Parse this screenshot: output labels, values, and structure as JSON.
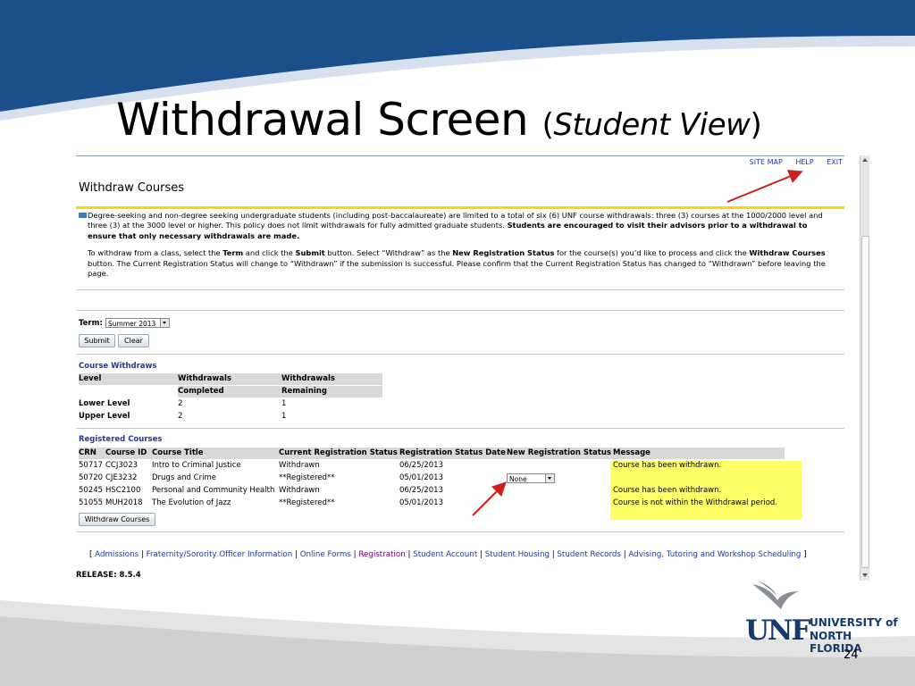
{
  "slide": {
    "title_main": "Withdrawal Screen",
    "title_paren_open": "(",
    "title_sub": "Student View",
    "title_paren_close": ")",
    "page_number": "24",
    "colors": {
      "header_blue": "#1a4f8c",
      "logo_navy": "#16396b",
      "footer_gray": "#d8d8d8"
    }
  },
  "logo": {
    "mark": "UNF",
    "line1": "UNIVERSITY of",
    "line2": "NORTH FLORIDA",
    "icon": "osprey-bird-icon"
  },
  "screen": {
    "top_links": [
      "SITE MAP",
      "HELP",
      "EXIT"
    ],
    "heading": "Withdraw Courses",
    "info": {
      "p1_before": "Degree-seeking and non-degree seeking undergraduate students (including post-baccalaureate) are limited to a total of six (6) UNF course withdrawals: three (3) courses at the 1000/2000 level and three (3) at the 3000 level or higher. This policy does not limit withdrawals for fully admitted graduate students. ",
      "p1_bold": "Students are encouraged to visit their advisors prior to a withdrawal to ensure that only necessary withdrawals are made.",
      "p2_a": "To withdraw from a class, select the ",
      "p2_b": "Term",
      "p2_c": " and click the ",
      "p2_d": "Submit",
      "p2_e": " button. Select “Withdraw” as the ",
      "p2_f": "New Registration Status",
      "p2_g": " for the course(s) you’d like to process and click the ",
      "p2_h": "Withdraw Courses",
      "p2_i": " button. The Current Registration Status will change to “Withdrawn” if the submission is successful. Please confirm that the Current Registration Status has changed to “Withdrawn” before leaving the page."
    },
    "term_label": "Term:",
    "term_value": "Summer 2013",
    "submit_label": "Submit",
    "clear_label": "Clear",
    "course_withdraws": {
      "title": "Course Withdraws",
      "headers": [
        "Level",
        "Withdrawals",
        "Withdrawals"
      ],
      "headers2": [
        "",
        "Completed",
        "Remaining"
      ],
      "rows": [
        [
          "Lower Level",
          "2",
          "1"
        ],
        [
          "Upper Level",
          "2",
          "1"
        ]
      ]
    },
    "registered_courses": {
      "title": "Registered Courses",
      "headers": [
        "CRN",
        "Course ID",
        "Course Title",
        "Current Registration Status",
        "Registration Status Date",
        "New Registration Status",
        "Message"
      ],
      "rows": [
        {
          "crn": "50717",
          "id": "CCJ3023",
          "title": "Intro to Criminal Justice",
          "status": "Withdrawn",
          "date": "06/25/2013",
          "new": "",
          "msg": "Course has been withdrawn."
        },
        {
          "crn": "50720",
          "id": "CJE3232",
          "title": "Drugs and Crime",
          "status": "**Registered**",
          "date": "05/01/2013",
          "new": "None",
          "msg": ""
        },
        {
          "crn": "50245",
          "id": "HSC2100",
          "title": "Personal and Community Health",
          "status": "Withdrawn",
          "date": "06/25/2013",
          "new": "",
          "msg": "Course has been withdrawn."
        },
        {
          "crn": "51055",
          "id": "MUH2018",
          "title": "The Evolution of Jazz",
          "status": "**Registered**",
          "date": "05/01/2013",
          "new": "",
          "msg": "Course is not within the Withdrawal period."
        }
      ],
      "highlight_color": "#ffff66"
    },
    "withdraw_button": "Withdraw Courses",
    "footer_links": [
      "Admissions",
      "Fraternity/Sorority Officer Information",
      "Online Forms",
      "Registration",
      "Student Account",
      "Student Housing",
      "Student Records",
      "Advising, Tutoring and Workshop Scheduling"
    ],
    "release": "RELEASE: 8.5.4"
  },
  "annotations": {
    "arrow_color": "#cc1f1f"
  }
}
